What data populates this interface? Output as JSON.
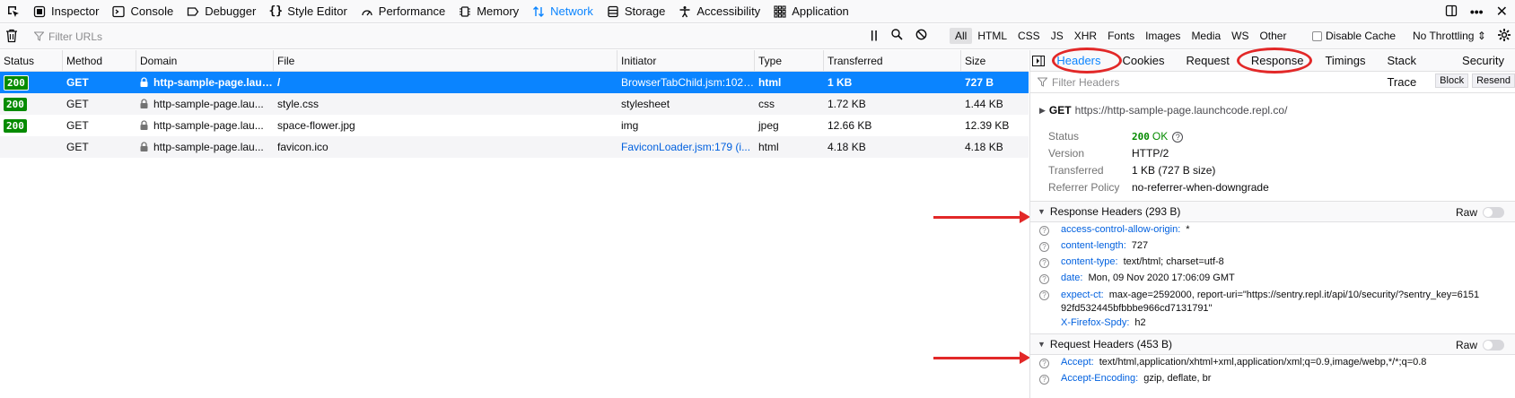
{
  "toolbar": {
    "tabs": [
      {
        "label": "Inspector",
        "icon": "inspector-icon"
      },
      {
        "label": "Console",
        "icon": "console-icon"
      },
      {
        "label": "Debugger",
        "icon": "debugger-icon"
      },
      {
        "label": "Style Editor",
        "icon": "style-editor-icon"
      },
      {
        "label": "Performance",
        "icon": "performance-icon"
      },
      {
        "label": "Memory",
        "icon": "memory-icon"
      },
      {
        "label": "Network",
        "icon": "network-icon",
        "active": true
      },
      {
        "label": "Storage",
        "icon": "storage-icon"
      },
      {
        "label": "Accessibility",
        "icon": "accessibility-icon"
      },
      {
        "label": "Application",
        "icon": "application-icon"
      }
    ]
  },
  "filterbar": {
    "placeholder": "Filter URLs",
    "types": [
      "All",
      "HTML",
      "CSS",
      "JS",
      "XHR",
      "Fonts",
      "Images",
      "Media",
      "WS",
      "Other"
    ],
    "active_type": "All",
    "disable_cache": "Disable Cache",
    "throttling": "No Throttling ⇕"
  },
  "columns": [
    "Status",
    "Method",
    "Domain",
    "File",
    "Initiator",
    "Type",
    "Transferred",
    "Size"
  ],
  "requests": [
    {
      "status": "200",
      "method": "GET",
      "domain": "http-sample-page.laun...",
      "file": "/",
      "initiator": "BrowserTabChild.jsm:102 ...",
      "type": "html",
      "transferred": "1 KB",
      "size": "727 B"
    },
    {
      "status": "200",
      "method": "GET",
      "domain": "http-sample-page.lau...",
      "file": "style.css",
      "initiator": "stylesheet",
      "type": "css",
      "transferred": "1.72 KB",
      "size": "1.44 KB"
    },
    {
      "status": "200",
      "method": "GET",
      "domain": "http-sample-page.lau...",
      "file": "space-flower.jpg",
      "initiator": "img",
      "type": "jpeg",
      "transferred": "12.66 KB",
      "size": "12.39 KB"
    },
    {
      "status": "",
      "method": "GET",
      "domain": "http-sample-page.lau...",
      "file": "favicon.ico",
      "initiator": "FaviconLoader.jsm:179 (i...",
      "type": "html",
      "transferred": "4.18 KB",
      "size": "4.18 KB"
    }
  ],
  "side": {
    "tabs": [
      "Headers",
      "Cookies",
      "Request",
      "Response",
      "Timings",
      "Stack Trace",
      "Security"
    ],
    "filter_placeholder": "Filter Headers",
    "block": "Block",
    "resend": "Resend",
    "method": "GET",
    "url": "https://http-sample-page.launchcode.repl.co/",
    "summary": {
      "status_label": "Status",
      "status_code": "200",
      "status_text": "OK",
      "version_label": "Version",
      "version": "HTTP/2",
      "transferred_label": "Transferred",
      "transferred": "1 KB (727 B size)",
      "referrer_label": "Referrer Policy",
      "referrer": "no-referrer-when-downgrade"
    },
    "response_headers_title": "Response Headers (293 B)",
    "request_headers_title": "Request Headers (453 B)",
    "raw": "Raw",
    "response_headers": [
      {
        "name": "access-control-allow-origin:",
        "value": "*"
      },
      {
        "name": "content-length:",
        "value": "727"
      },
      {
        "name": "content-type:",
        "value": "text/html; charset=utf-8"
      },
      {
        "name": "date:",
        "value": "Mon, 09 Nov 2020 17:06:09 GMT"
      },
      {
        "name": "expect-ct:",
        "value": "max-age=2592000, report-uri=\"https://sentry.repl.it/api/10/security/?sentry_key=615192fd532445bfbbbe966cd7131791\""
      },
      {
        "name": "X-Firefox-Spdy:",
        "value": "h2"
      }
    ],
    "request_headers": [
      {
        "name": "Accept:",
        "value": "text/html,application/xhtml+xml,application/xml;q=0.9,image/webp,*/*;q=0.8"
      },
      {
        "name": "Accept-Encoding:",
        "value": "gzip, deflate, br"
      }
    ]
  },
  "colors": {
    "accent": "#0a84ff",
    "status_ok": "#058b00",
    "annotation": "#e22828"
  }
}
